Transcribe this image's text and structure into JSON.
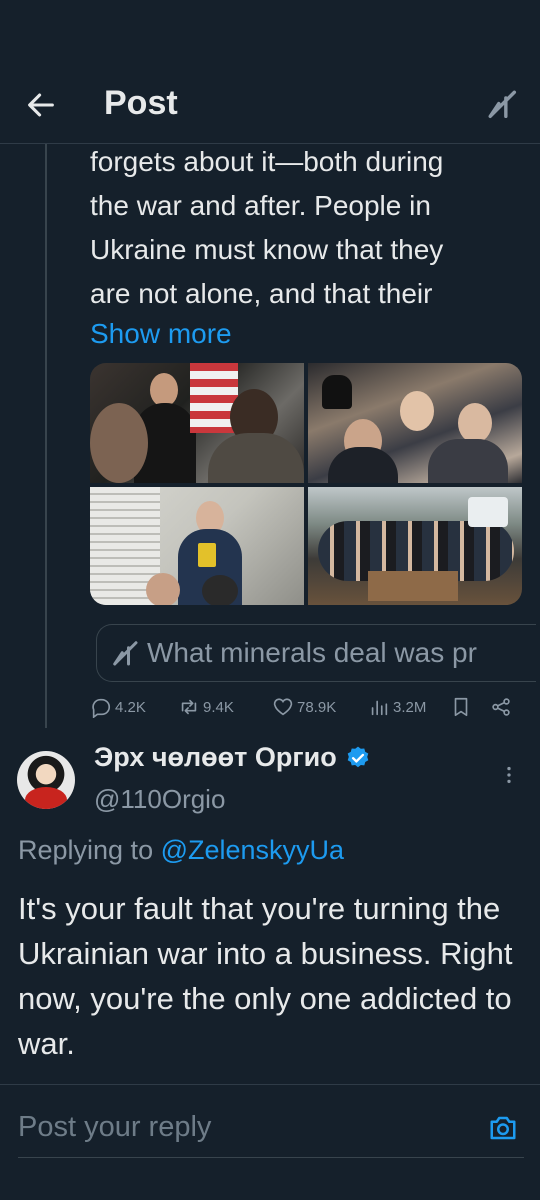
{
  "header": {
    "title": "Post",
    "back_icon": "arrow-left-icon",
    "grok_icon": "grok-icon"
  },
  "tweet": {
    "text": "forgets about it—both during\nthe war and after. People in\nUkraine must know that they\nare not alone, and that their",
    "show_more": "Show more",
    "quote": {
      "text": "What minerals deal was pr",
      "icon": "grok-icon"
    },
    "stats": {
      "replies": "4.2K",
      "reposts": "9.4K",
      "likes": "78.9K",
      "views": "3.2M"
    }
  },
  "reply": {
    "name": "Эрх чөлөөт Оргио",
    "handle": "@110Orgio",
    "replying_prefix": "Replying to ",
    "replying_to": "@ZelenskyyUa",
    "text": "It's your fault that you're turning the Ukrainian war into a business. Right now, you're the only one addicted to war."
  },
  "composer": {
    "placeholder": "Post your reply"
  },
  "colors": {
    "background": "#15202b",
    "accent": "#1d9bf0",
    "muted": "#8b98a5",
    "text": "#e7e9ea"
  }
}
